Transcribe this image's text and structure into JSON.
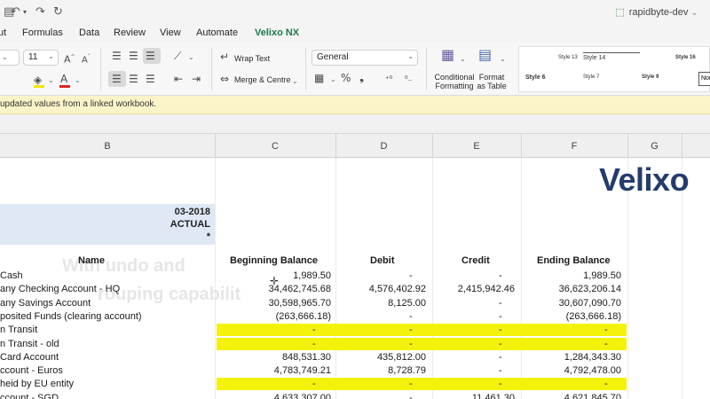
{
  "title_bar": {
    "file_name": "rapidbyte-dev",
    "icons": [
      "save-icon",
      "undo-icon",
      "undo-dropdown-icon",
      "redo-icon",
      "refresh-icon"
    ]
  },
  "menu": {
    "tabs": [
      "ut",
      "Formulas",
      "Data",
      "Review",
      "View",
      "Automate",
      "Velixo NX"
    ],
    "active": "Velixo NX"
  },
  "ribbon": {
    "font_size": "11",
    "wrap_text_label": "Wrap Text",
    "merge_label": "Merge & Centre",
    "number_format": "General",
    "conditional_formatting_label": [
      "Conditional",
      "Formatting"
    ],
    "format_table_label": [
      "Format",
      "as Table"
    ],
    "styles": {
      "row1": [
        "Style 13",
        "Style 14",
        "Style 16"
      ],
      "row2": [
        "Style 6",
        "Style 7",
        "Style 9"
      ],
      "normal": "Nor"
    }
  },
  "notice": {
    "text": "updated values from a linked workbook."
  },
  "columns": [
    "B",
    "C",
    "D",
    "E",
    "F",
    "G"
  ],
  "sheet": {
    "logo": "Velixo",
    "period": "03-2018",
    "scenario": "ACTUAL",
    "marker": "*",
    "headers": {
      "name": "Name",
      "beginning": "Beginning Balance",
      "debit": "Debit",
      "credit": "Credit",
      "ending": "Ending Balance"
    },
    "rows": [
      {
        "name": "Cash",
        "beginning": "1,989.50",
        "debit": "-",
        "credit": "-",
        "ending": "1,989.50",
        "highlight": false
      },
      {
        "name": "any Checking Account - HQ",
        "beginning": "34,462,745.68",
        "debit": "4,576,402.92",
        "credit": "2,415,942.46",
        "ending": "36,623,206.14",
        "highlight": false
      },
      {
        "name": "any Savings Account",
        "beginning": "30,598,965.70",
        "debit": "8,125.00",
        "credit": "-",
        "ending": "30,607,090.70",
        "highlight": false
      },
      {
        "name": "posited Funds (clearing account)",
        "beginning": "(263,666.18)",
        "debit": "-",
        "credit": "-",
        "ending": "(263,666.18)",
        "highlight": false
      },
      {
        "name": "n Transit",
        "beginning": "-",
        "debit": "-",
        "credit": "-",
        "ending": "-",
        "highlight": true
      },
      {
        "name": "n Transit - old",
        "beginning": "-",
        "debit": "-",
        "credit": "-",
        "ending": "-",
        "highlight": true
      },
      {
        "name": "Card Account",
        "beginning": "848,531.30",
        "debit": "435,812.00",
        "credit": "-",
        "ending": "1,284,343.30",
        "highlight": false
      },
      {
        "name": "ccount - Euros",
        "beginning": "4,783,749.21",
        "debit": "8,728.79",
        "credit": "-",
        "ending": "4,792,478.00",
        "highlight": false
      },
      {
        "name": "heid by EU entity",
        "beginning": "-",
        "debit": "-",
        "credit": "-",
        "ending": "-",
        "highlight": true
      },
      {
        "name": "ccount - SGD",
        "beginning": "4,633,307.00",
        "debit": "-",
        "credit": "11,461.30",
        "ending": "4,621,845.70",
        "highlight": false
      }
    ]
  },
  "overlay": {
    "line1": "With undo and",
    "line2": "rouping capabilit"
  },
  "colors": {
    "active_tab": "#1b7a4a",
    "highlight": "#f4f10a",
    "notice_bg": "#fbf4c9",
    "logo": "#243b6e",
    "period_bg": "#dfe8f4"
  }
}
